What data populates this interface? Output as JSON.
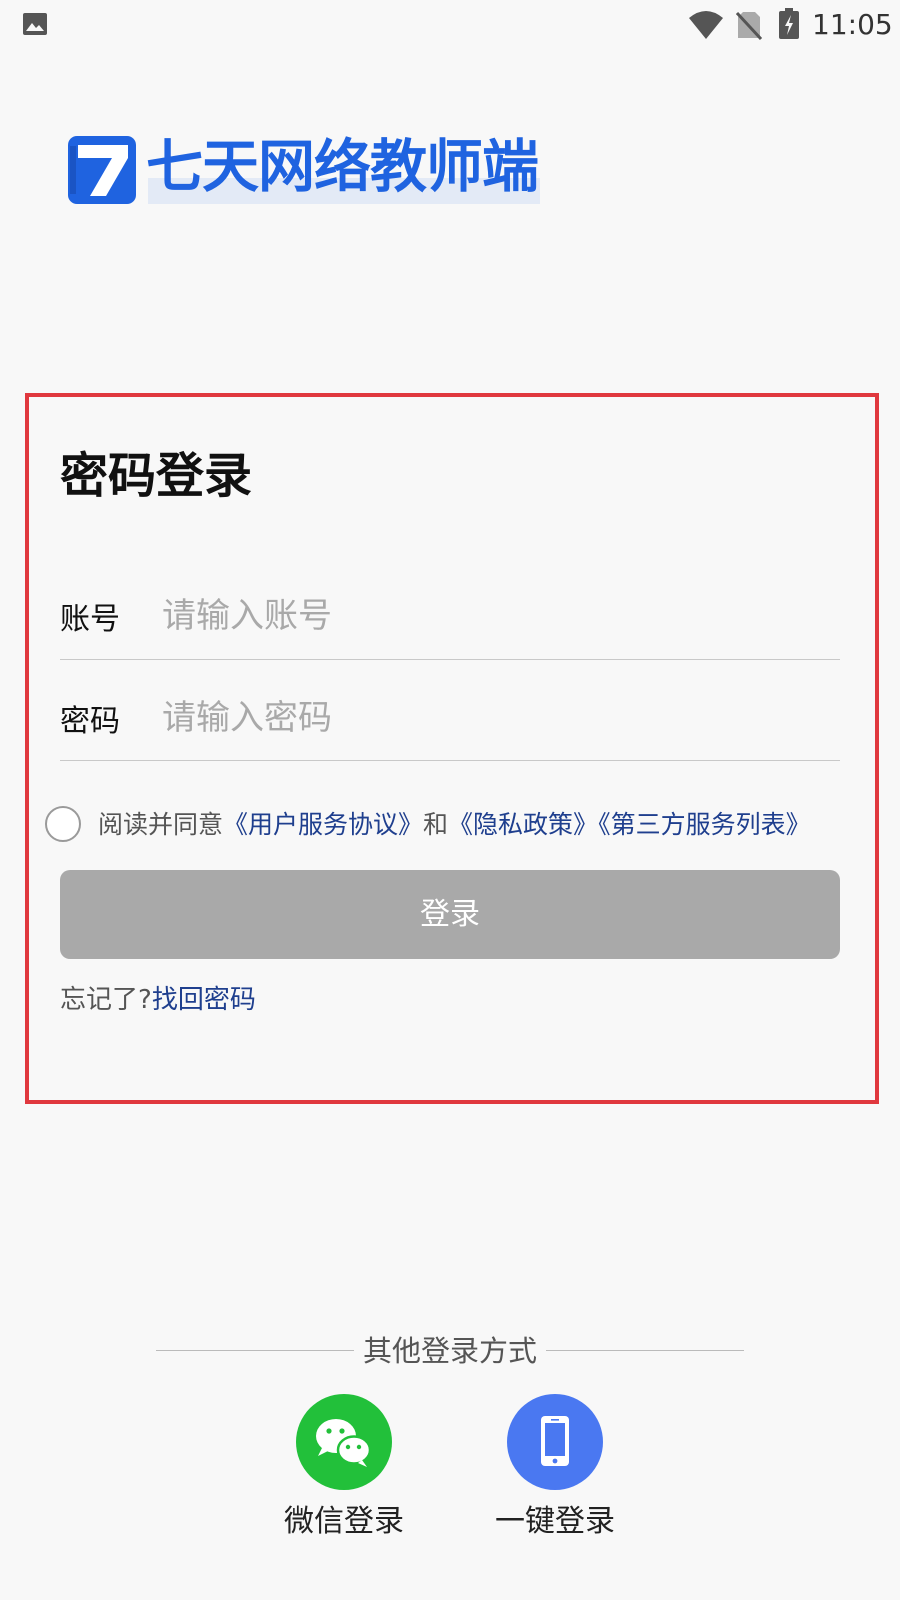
{
  "status_bar": {
    "time": "11:05",
    "icons": [
      "gallery-icon",
      "wifi-icon",
      "no-sim-icon",
      "battery-charging-icon"
    ]
  },
  "logo": {
    "text": "七天网络教师端",
    "colors": {
      "primary": "#1f63e0",
      "highlight": "#e3eaf6"
    }
  },
  "login": {
    "title": "密码登录",
    "account": {
      "label": "账号",
      "placeholder": "请输入账号",
      "value": ""
    },
    "password": {
      "label": "密码",
      "placeholder": "请输入密码",
      "value": ""
    },
    "agreement": {
      "checked": false,
      "prefix": "阅读并同意",
      "user_agreement": "《用户服务协议》",
      "and": "和",
      "privacy_policy": "《隐私政策》",
      "third_party": "《第三方服务列表》"
    },
    "submit_label": "登录",
    "forgot_prefix": "忘记了?",
    "forgot_link": "找回密码",
    "highlight_color": "#e0383e"
  },
  "other_login": {
    "title": "其他登录方式",
    "methods": [
      {
        "label": "微信登录",
        "icon": "wechat-icon",
        "color": "#22c03a"
      },
      {
        "label": "一键登录",
        "icon": "phone-icon",
        "color": "#4a78f1"
      }
    ]
  }
}
